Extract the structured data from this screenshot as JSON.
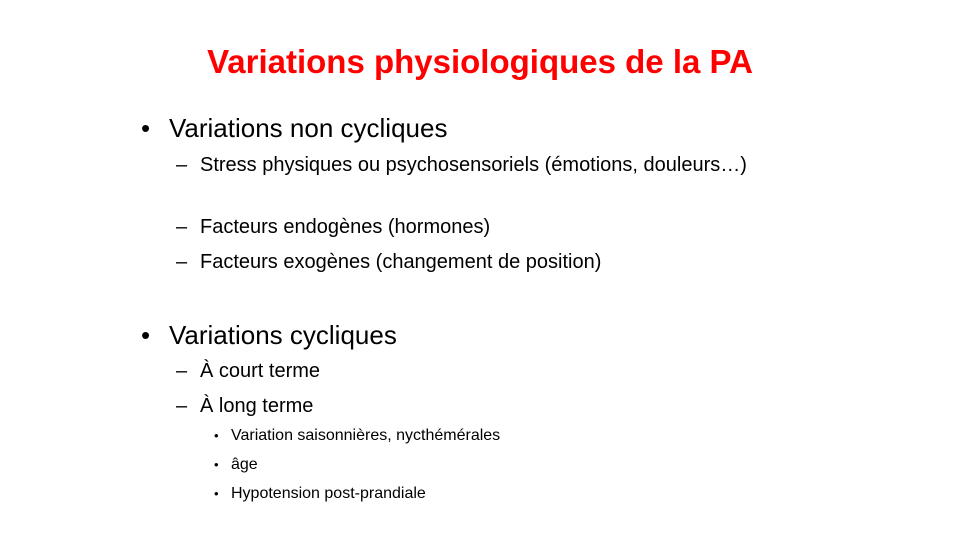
{
  "slide": {
    "title": "Variations physiologiques de la PA",
    "title_color": "#ff0000",
    "bullet_l1": "•",
    "bullet_l2": "–",
    "bullet_l3": "•",
    "sections": [
      {
        "heading": "Variations non cycliques",
        "items": [
          {
            "text": "Stress physiques ou psychosensoriels (émotions, douleurs…)"
          },
          {
            "text": "Facteurs endogènes (hormones)"
          },
          {
            "text": "Facteurs exogènes (changement de position)"
          }
        ]
      },
      {
        "heading": "Variations cycliques",
        "items": [
          {
            "text": "À court terme"
          },
          {
            "text": "À long terme",
            "subitems": [
              "Variation saisonnières, nycthémérales",
              "âge",
              "Hypotension post-prandiale"
            ]
          }
        ]
      }
    ]
  }
}
